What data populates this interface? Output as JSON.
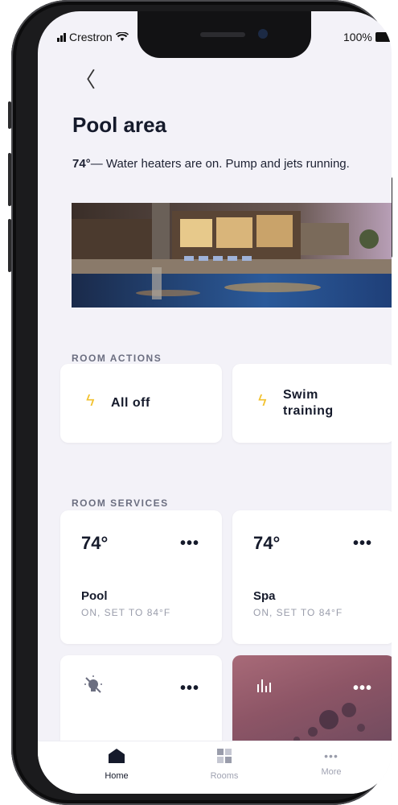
{
  "status_bar": {
    "carrier": "Crestron",
    "battery": "100%"
  },
  "header": {
    "back_icon": "chevron-left-icon",
    "back_glyph": "〈",
    "title": "Pool area"
  },
  "description": {
    "temp": "74°",
    "text": "— Water heaters are on. Pump and jets running."
  },
  "room_actions": {
    "label": "ROOM ACTIONS",
    "items": [
      {
        "label": "All off",
        "icon": "lightning-icon"
      },
      {
        "label_line1": "Swim",
        "label_line2": "training",
        "icon": "lightning-icon"
      }
    ]
  },
  "room_services": {
    "label": "ROOM SERVICES",
    "items": [
      {
        "temp": "74°",
        "name": "Pool",
        "status": "ON, SET TO 84°F",
        "more": "•••"
      },
      {
        "temp": "74°",
        "name": "Spa",
        "status": "ON, SET TO 84°F",
        "more": "•••"
      },
      {
        "icon": "light-off-icon",
        "more": "•••"
      },
      {
        "icon": "music-equalizer-icon",
        "more": "•••"
      }
    ]
  },
  "tab_bar": {
    "items": [
      {
        "label": "Home",
        "icon": "home-icon",
        "active": true
      },
      {
        "label": "Rooms",
        "icon": "rooms-grid-icon",
        "active": false
      },
      {
        "label": "More",
        "icon": "more-icon",
        "glyph": "•••",
        "active": false
      }
    ]
  },
  "colors": {
    "background": "#f3f2f8",
    "accent": "#f2c230",
    "text": "#151a2b",
    "muted": "#9a9dab"
  }
}
